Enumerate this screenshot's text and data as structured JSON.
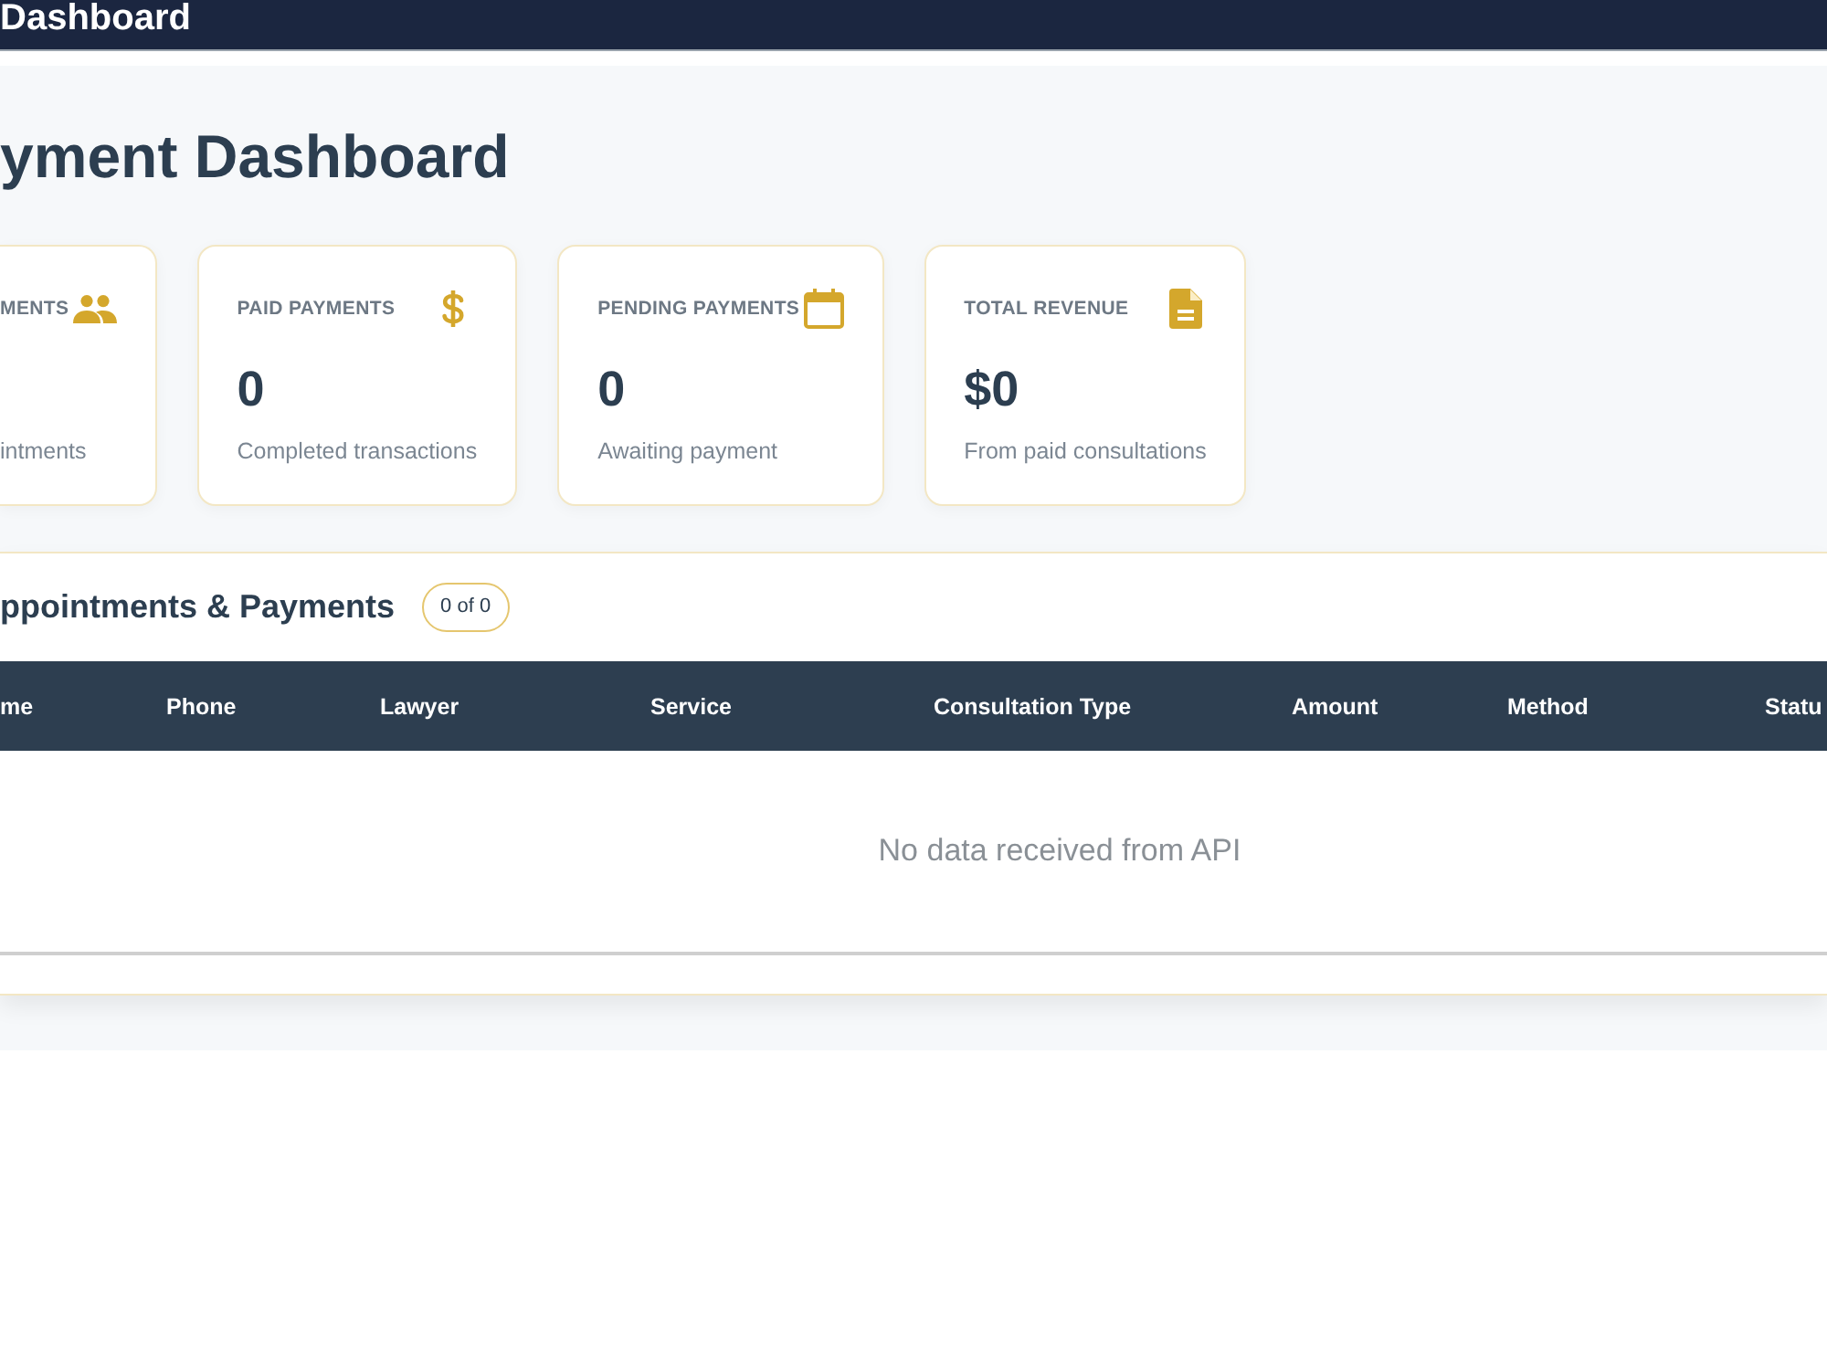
{
  "navbar": {
    "title": "Dashboard"
  },
  "page": {
    "heading": "yment Dashboard"
  },
  "stat_cards": [
    {
      "kind": "people",
      "label": "MENTS",
      "subtitle": "intments"
    },
    {
      "kind": "dollar",
      "label": "PAID PAYMENTS",
      "value": "0",
      "subtitle": "Completed transactions"
    },
    {
      "kind": "calendar",
      "label": "PENDING PAYMENTS",
      "value": "0",
      "subtitle": "Awaiting payment"
    },
    {
      "kind": "document",
      "label": "TOTAL REVENUE",
      "value": "$0",
      "subtitle": "From paid consultations"
    }
  ],
  "appointments_panel": {
    "title": "ppointments & Payments",
    "count_badge": "0 of 0",
    "table": {
      "columns": [
        "me",
        "Phone",
        "Lawyer",
        "Service",
        "Consultation Type",
        "Amount",
        "Method",
        "Statu"
      ],
      "empty_message": "No data received from API"
    }
  }
}
